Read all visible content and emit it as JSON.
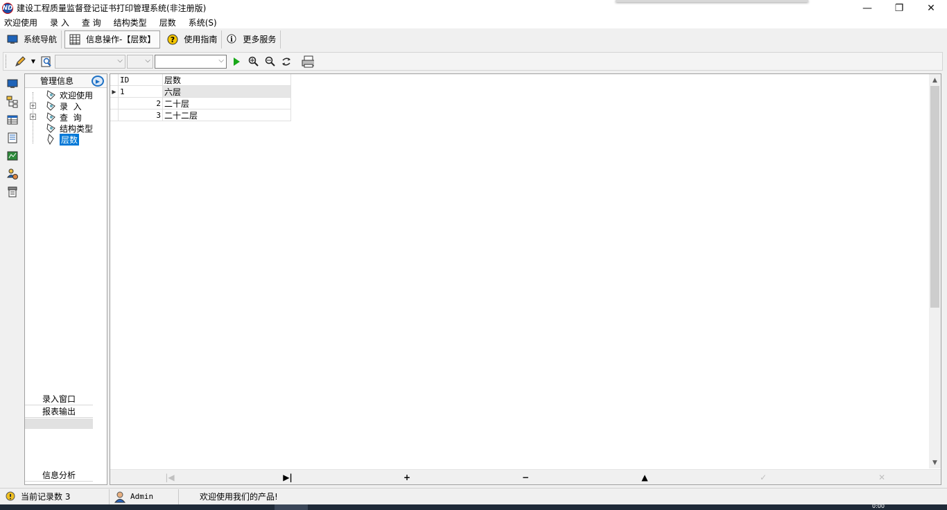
{
  "window": {
    "title": "建设工程质量监督登记证书打印管理系统(非注册版)",
    "icon_text": "ND",
    "controls": [
      "—",
      "❐",
      "✕"
    ]
  },
  "menu": [
    "欢迎使用",
    "录 入",
    "查 询",
    "结构类型",
    "层数",
    "系统(S)"
  ],
  "nav_toolbar": [
    {
      "label": "系统导航",
      "icon": "monitor-icon",
      "active": false
    },
    {
      "label": "信息操作-【层数】",
      "icon": "grid-icon",
      "active": true
    },
    {
      "label": "使用指南",
      "icon": "help-icon",
      "active": false
    },
    {
      "label": "更多服务",
      "icon": "info-icon",
      "active": false
    }
  ],
  "edit_toolbar": {
    "field_combo_value": "",
    "operator_combo_value": "",
    "search_value": "",
    "icons": [
      "pencil-icon",
      "dropdown-arrow-icon",
      "find-icon",
      "run-icon",
      "filter-add-icon",
      "filter-remove-icon",
      "refresh-icon",
      "print-icon"
    ]
  },
  "side_icons": [
    "monitor-icon",
    "structure-icon",
    "table-icon",
    "document-icon",
    "chart-icon",
    "user-settings-icon",
    "printer-doc-icon"
  ],
  "panel": {
    "header": "管理信息",
    "tree": [
      {
        "label": "欢迎使用",
        "expandable": false,
        "selected": false
      },
      {
        "label": "录  入",
        "expandable": true,
        "selected": false
      },
      {
        "label": "查  询",
        "expandable": true,
        "selected": false
      },
      {
        "label": "结构类型",
        "expandable": false,
        "selected": false
      },
      {
        "label": "层数",
        "expandable": false,
        "selected": true
      }
    ],
    "sections": [
      "录入窗口",
      "报表输出"
    ],
    "bottom_section": "信息分析"
  },
  "grid": {
    "columns": [
      "ID",
      "层数"
    ],
    "rows": [
      {
        "id": "1",
        "name": "六层",
        "current": true
      },
      {
        "id": "2",
        "name": "二十层",
        "current": false
      },
      {
        "id": "3",
        "name": "二十二层",
        "current": false
      }
    ]
  },
  "navigator": [
    "first",
    "last",
    "insert",
    "delete",
    "edit",
    "post",
    "cancel"
  ],
  "status": {
    "record_count_label": "当前记录数 3",
    "user": "Admin",
    "message": "欢迎使用我们的产品!"
  },
  "taskbar": {
    "clock": "0:00"
  }
}
